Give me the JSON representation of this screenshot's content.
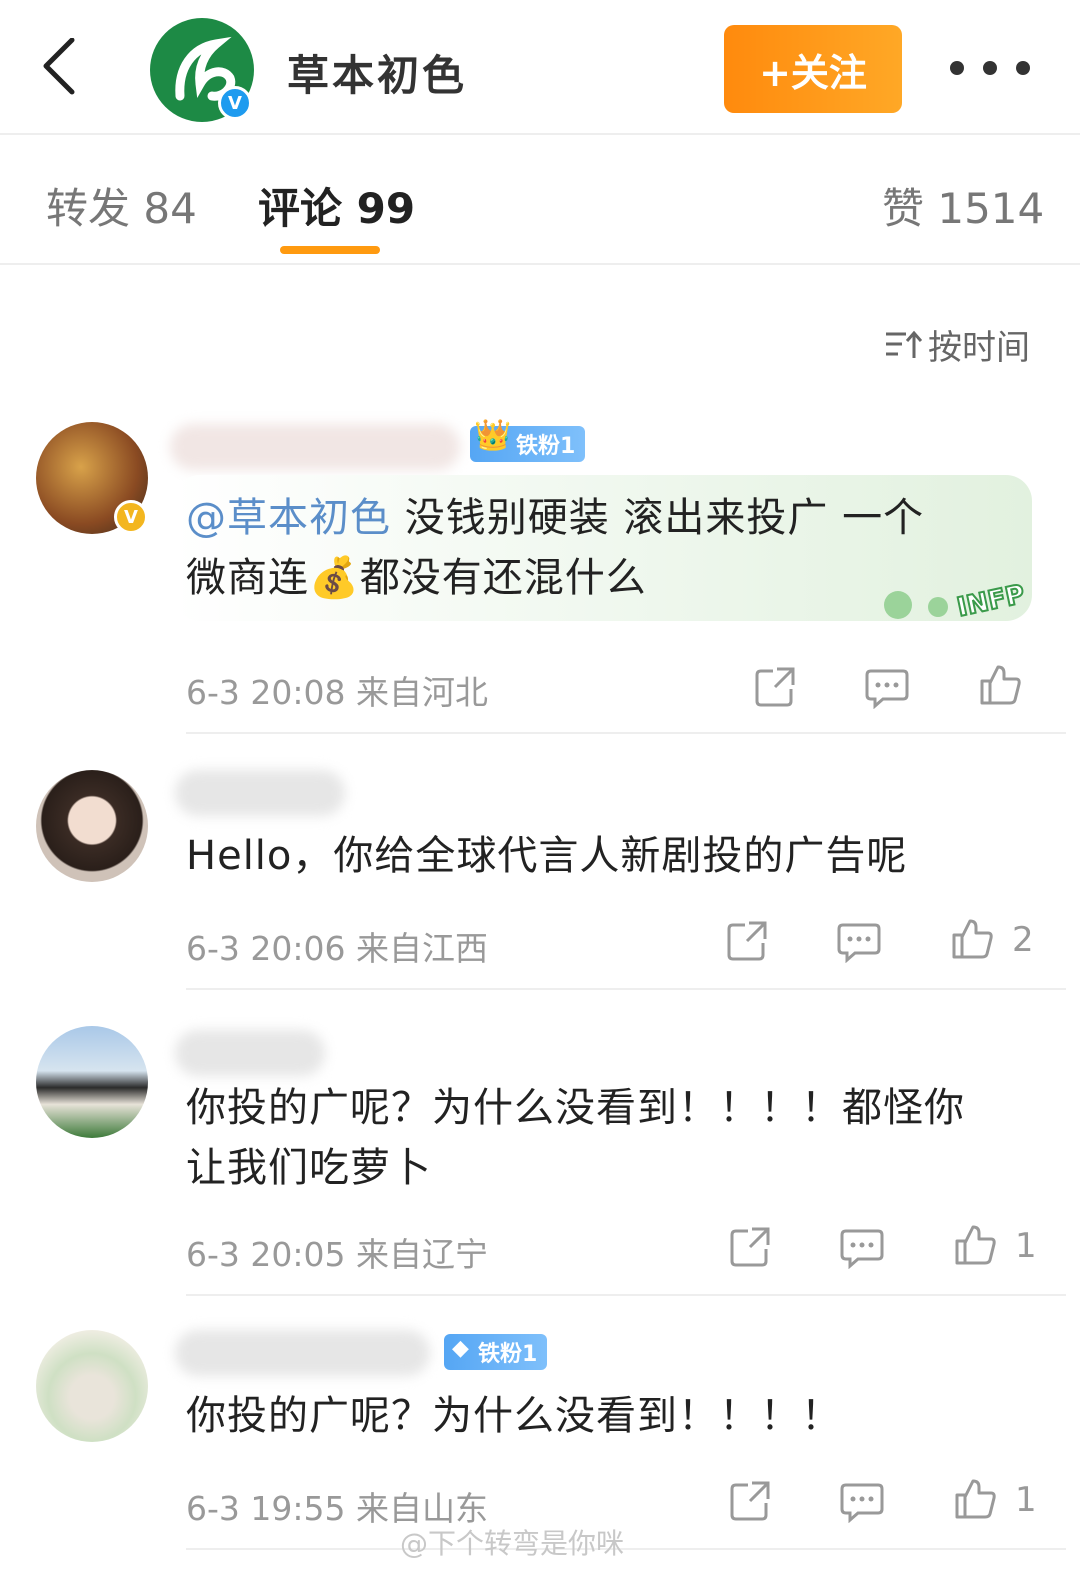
{
  "header": {
    "title": "草本初色",
    "follow_label": "+关注",
    "verified_badge": "V",
    "icons": {
      "back": "back-arrow-icon",
      "more": "more-dots-icon"
    }
  },
  "tabs": {
    "repost": "转发 84",
    "comments": "评论 99",
    "likes": "赞 1514"
  },
  "sort": {
    "label": "按时间",
    "icon": "sort-icon"
  },
  "comments": [
    {
      "badge": "铁粉1",
      "verified": "V",
      "mention": "@草本初色",
      "text_line1": " 没钱别硬装 滚出来投广 一个",
      "text_line2_a": "微商连",
      "text_line2_b": "都没有还混什么",
      "meta": "6-3 20:08  来自河北",
      "bubble_text": "INFP"
    },
    {
      "text": "Hello，你给全球代言人新剧投的广告呢",
      "meta": "6-3 20:06  来自江西",
      "likes": "2"
    },
    {
      "text_line1": "你投的广呢？为什么没看到！！！！都怪你",
      "text_line2": "让我们吃萝卜",
      "meta": "6-3 20:05  来自辽宁",
      "likes": "1"
    },
    {
      "badge": "铁粉1",
      "text": "你投的广呢？为什么没看到！！！！",
      "meta": "6-3 19:55  来自山东",
      "likes": "1"
    }
  ],
  "watermark": "@下个转弯是你咪",
  "colors": {
    "accent": "#ff9a10",
    "mention": "#5b8ec9",
    "brand_green": "#1d8a45"
  }
}
